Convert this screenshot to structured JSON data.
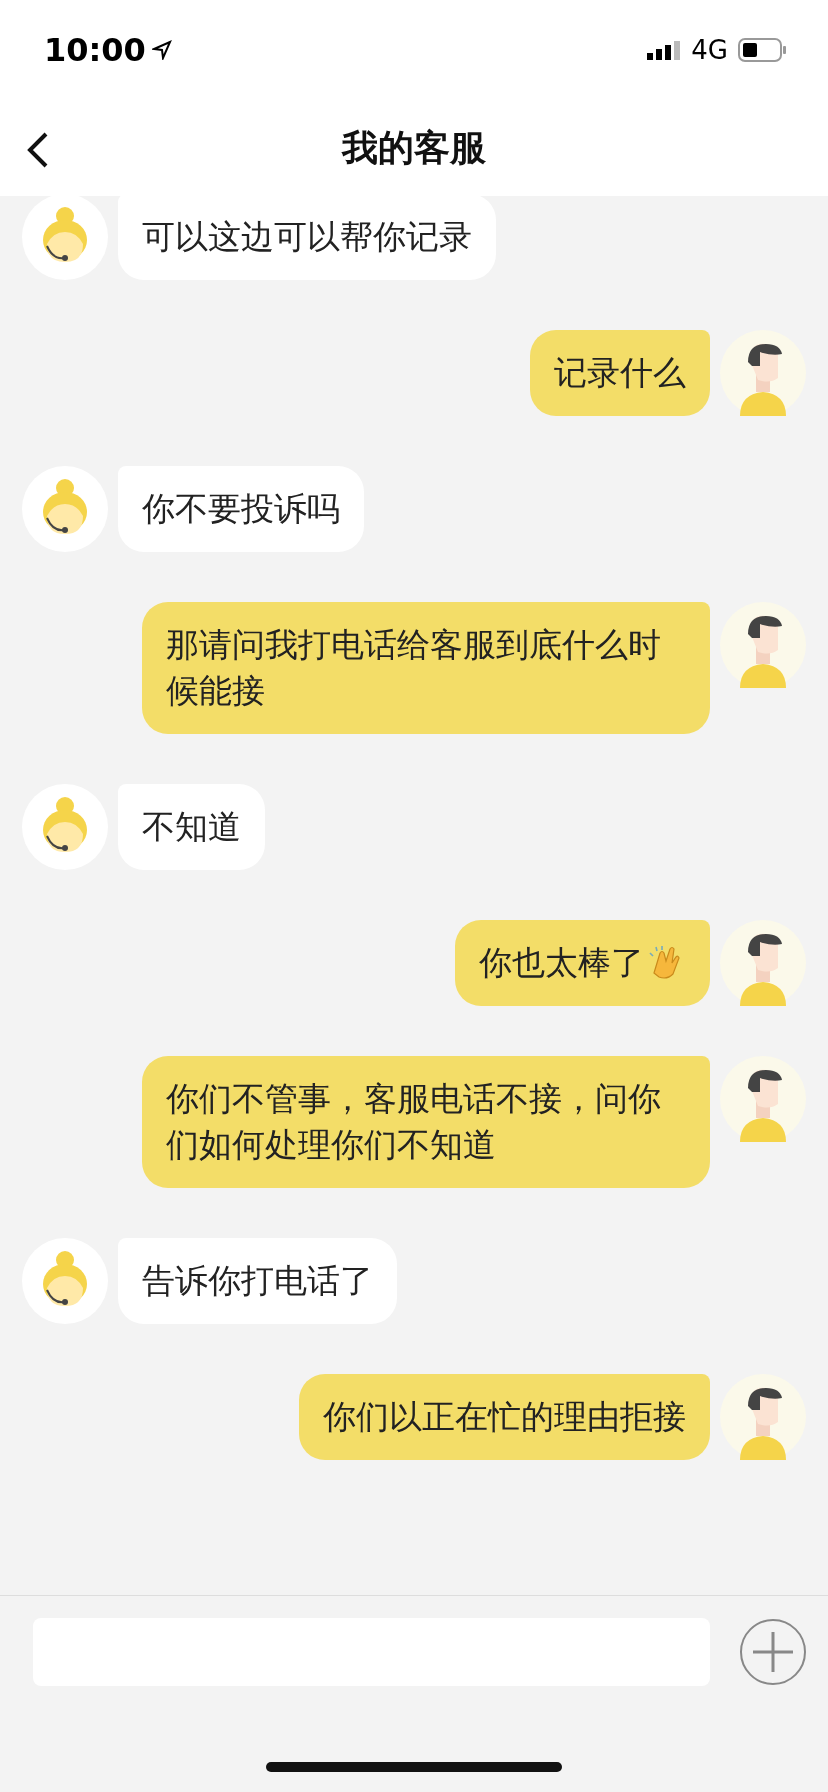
{
  "status_bar": {
    "time": "10:00",
    "network": "4G"
  },
  "nav": {
    "title": "我的客服"
  },
  "messages": [
    {
      "kind": "agent",
      "text": "可以这边可以帮你记录"
    },
    {
      "kind": "user",
      "text": "记录什么"
    },
    {
      "kind": "agent",
      "text": "你不要投诉吗"
    },
    {
      "kind": "user",
      "text": "那请问我打电话给客服到底什么时候能接"
    },
    {
      "kind": "agent",
      "text": "不知道"
    },
    {
      "kind": "user",
      "text": "你也太棒了",
      "clap_emoji": true
    },
    {
      "kind": "user",
      "text": "你们不管事，客服电话不接，问你们如何处理你们不知道"
    },
    {
      "kind": "agent",
      "text": "告诉你打电话了"
    },
    {
      "kind": "user",
      "text": "你们以正在忙的理由拒接"
    }
  ]
}
